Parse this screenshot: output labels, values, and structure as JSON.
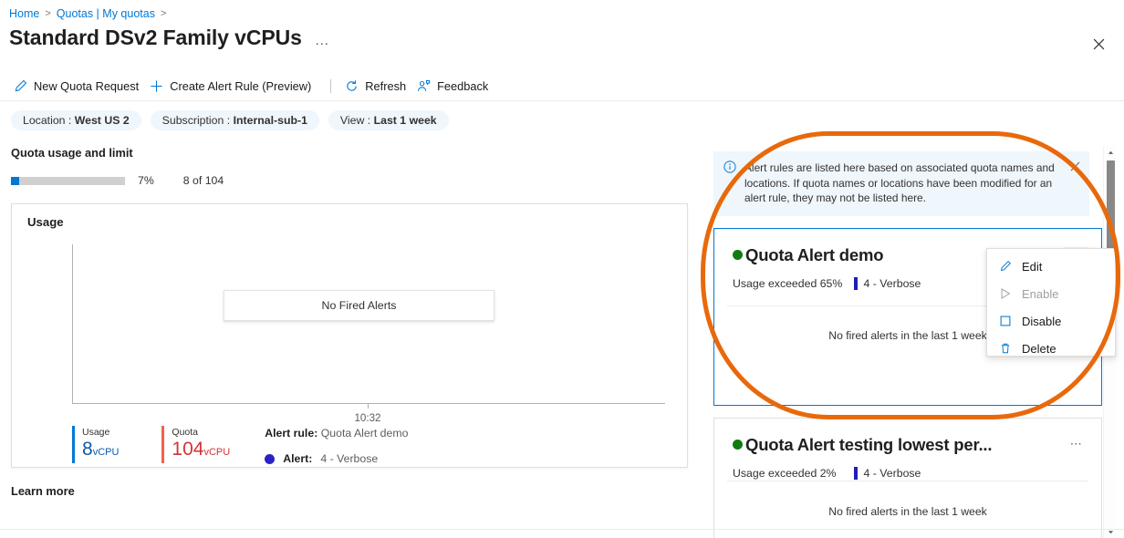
{
  "breadcrumb": {
    "home": "Home",
    "quotas": "Quotas | My quotas",
    "sep": ">"
  },
  "header": {
    "title": "Standard DSv2 Family vCPUs",
    "ellipsis": "…",
    "close_icon": "close-icon"
  },
  "toolbar": {
    "new_quota_request": "New Quota Request",
    "create_alert_rule": "Create Alert Rule (Preview)",
    "refresh": "Refresh",
    "feedback": "Feedback",
    "icons": {
      "pencil": "pencil-icon",
      "plus": "plus-icon",
      "refresh": "refresh-icon",
      "feedback": "feedback-icon"
    }
  },
  "filters": [
    {
      "label": "Location :",
      "value": "West US 2"
    },
    {
      "label": "Subscription :",
      "value": "Internal-sub-1"
    },
    {
      "label": "View :",
      "value": "Last 1 week"
    }
  ],
  "quota": {
    "section_title": "Quota usage and limit",
    "percent_label": "7%",
    "percent_value": 7,
    "of_label": "8 of 104"
  },
  "usage_card": {
    "title": "Usage",
    "no_fired_alerts": "No Fired Alerts",
    "x_tick": "10:32",
    "legend": {
      "usage_name": "Usage",
      "usage_value": "8",
      "usage_unit": "vCPU",
      "quota_name": "Quota",
      "quota_value": "104",
      "quota_unit": "vCPU",
      "alert_rule_label": "Alert rule:",
      "alert_rule_value": "Quota Alert demo",
      "alert_sev_label": "Alert:",
      "alert_sev_value": "4 - Verbose"
    }
  },
  "learn_more": "Learn more",
  "right_panel": {
    "info_banner": {
      "text": "Alert rules are listed here based on associated quota names and locations. If quota names or locations have been modified for an alert rule, they may not be listed here.",
      "info_icon": "info-icon",
      "close_icon": "close-icon"
    },
    "cards": [
      {
        "name": "Quota Alert demo",
        "status_dot": "green",
        "condition": "Usage exceeded 65%",
        "severity": "4 - Verbose",
        "empty_text": "No fired alerts in the last 1 week",
        "more_label": "⋯"
      },
      {
        "name": "Quota Alert testing lowest per...",
        "status_dot": "green",
        "condition": "Usage exceeded 2%",
        "severity": "4 - Verbose",
        "empty_text": "No fired alerts in the last 1 week",
        "more_label": "⋯"
      }
    ],
    "context_menu": [
      {
        "label": "Edit",
        "icon": "pencil-icon",
        "disabled": false
      },
      {
        "label": "Enable",
        "icon": "play-icon",
        "disabled": true
      },
      {
        "label": "Disable",
        "icon": "square-icon",
        "disabled": false
      },
      {
        "label": "Delete",
        "icon": "trash-icon",
        "disabled": false
      }
    ]
  },
  "colors": {
    "accent": "#0078d4",
    "usage": "#0078d4",
    "quota": "#f1624c",
    "status_ok": "#107c10",
    "severity": "#1f1fb5",
    "annotation_ring": "#e8690b"
  }
}
